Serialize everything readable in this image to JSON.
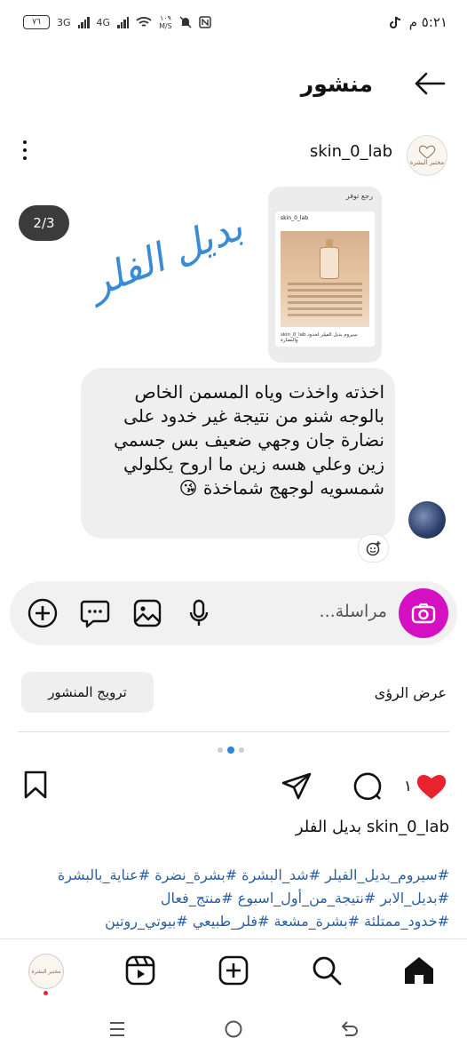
{
  "status_bar": {
    "time": "٥:٢١ م",
    "battery": "٧٦",
    "net1": "3G",
    "net2": "4G",
    "speed": "١٠٩",
    "speed_unit": "M/S"
  },
  "header": {
    "title": "منشور"
  },
  "post": {
    "username": "skin_0_lab",
    "avatar_text": "مختبر البشرة",
    "counter": "2/3",
    "overlay_text": "بديل الفلر",
    "thumb_top": "رجع توفر",
    "thumb_user": "skin_0_lab",
    "thumb_footer": "skin_0_lab سيروم بديل الفيلر لخدود والنضارة"
  },
  "message": {
    "text": "اخذته واخذت وياه المسمن الخاص\nبالوجه شنو من نتيجة غير خدود على\nنضارة جان وجهي ضعيف بس جسمي\nزين وعلي هسه زين ما اروح يكلولي\nشمسويه لوجهج شماخذة 😘"
  },
  "composer": {
    "placeholder": "مراسلة..."
  },
  "actions": {
    "boost_label": "ترويج المنشور",
    "insights_label": "عرض الرؤى",
    "likes_count": "١"
  },
  "caption": {
    "username": "skin_0_lab",
    "text": "بديل الفلر"
  },
  "hashtags": [
    "#سيروم_بديل_الفيلر #شد_البشرة #بشرة_نضرة #عناية_بالبشرة",
    "#بديل_الابر #نتيجة_من_أول_اسبوع #منتج_فعال",
    "#خدود_ممتلئة #بشرة_مشعة #فلر_طبيعي #بيوتي_روتين"
  ],
  "colors": {
    "camera_button": "#d510c3",
    "like_heart": "#e8222e",
    "hashtag": "#2a5fa0",
    "overlay_text": "#3a8bd6"
  }
}
